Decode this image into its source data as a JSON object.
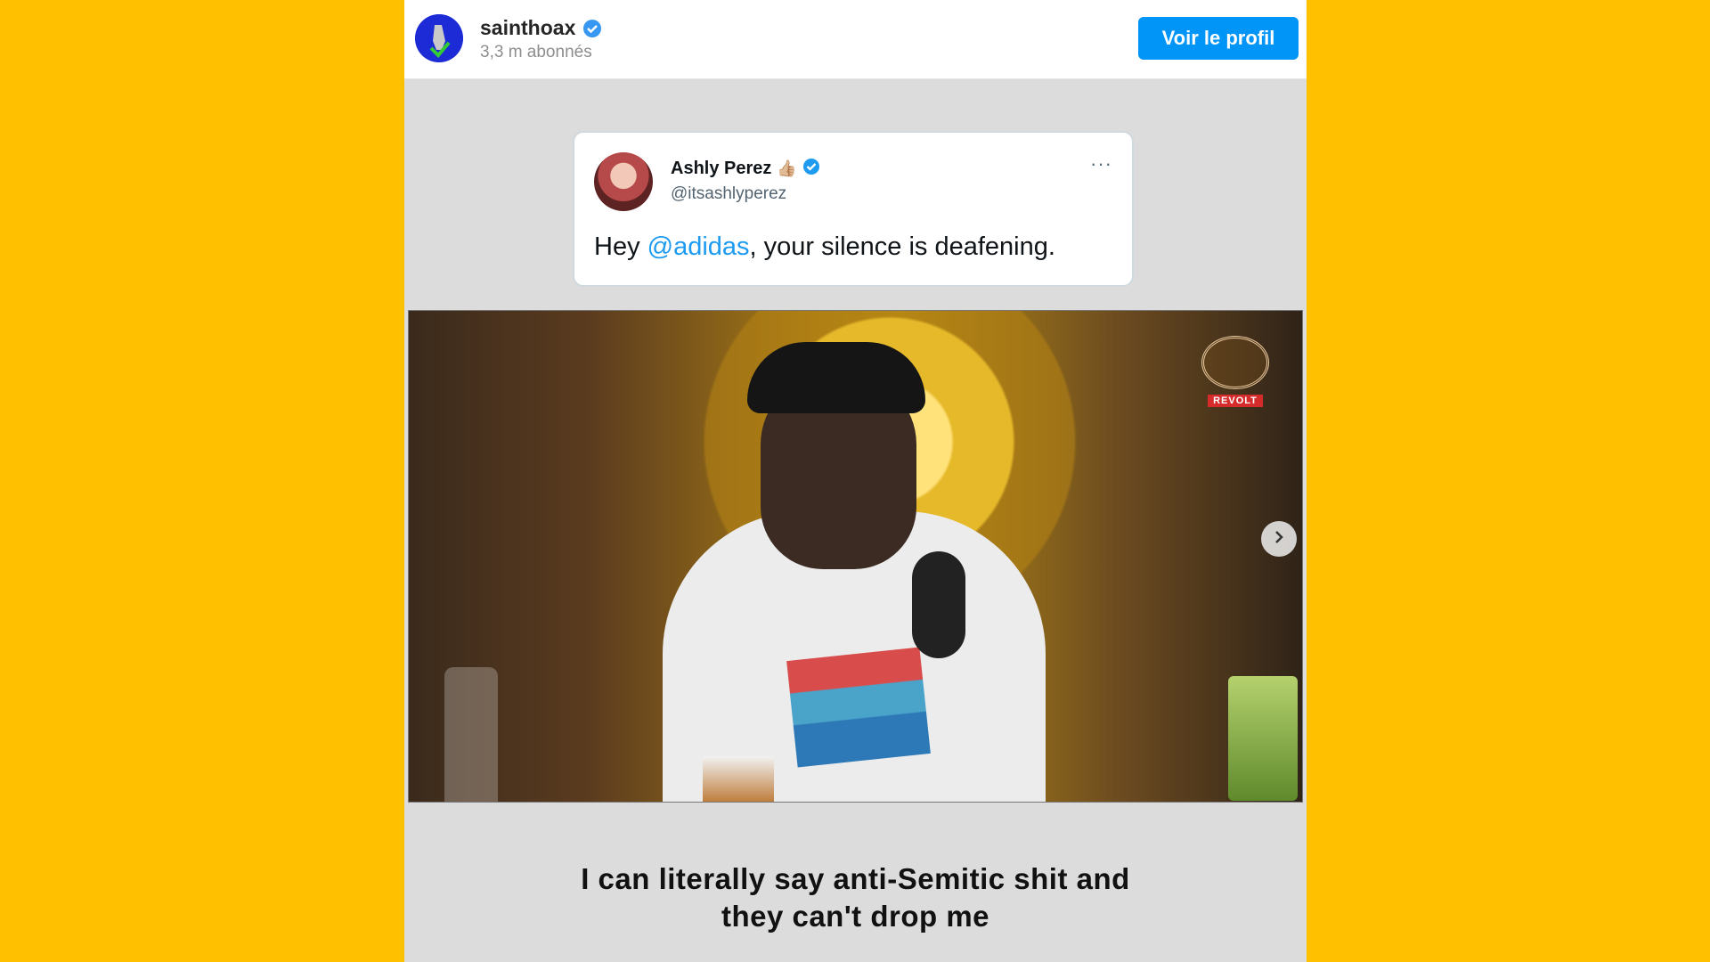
{
  "header": {
    "username": "sainthoax",
    "followers": "3,3 m abonnés",
    "profile_button": "Voir le profil"
  },
  "tweet": {
    "name": "Ashly Perez",
    "emoji": "👍🏼",
    "handle": "@itsashlyperez",
    "more": "···",
    "text_before": "Hey ",
    "mention": "@adidas",
    "text_after": ", your silence is deafening."
  },
  "video": {
    "badge_label": "REVOLT"
  },
  "caption": {
    "line1": "I can literally say anti-Semitic shit and",
    "line2": "they can't drop me"
  },
  "colors": {
    "background": "#FFC000",
    "button": "#0095f6",
    "mention": "#1d9bf0",
    "verified": "#1d9bf0"
  }
}
